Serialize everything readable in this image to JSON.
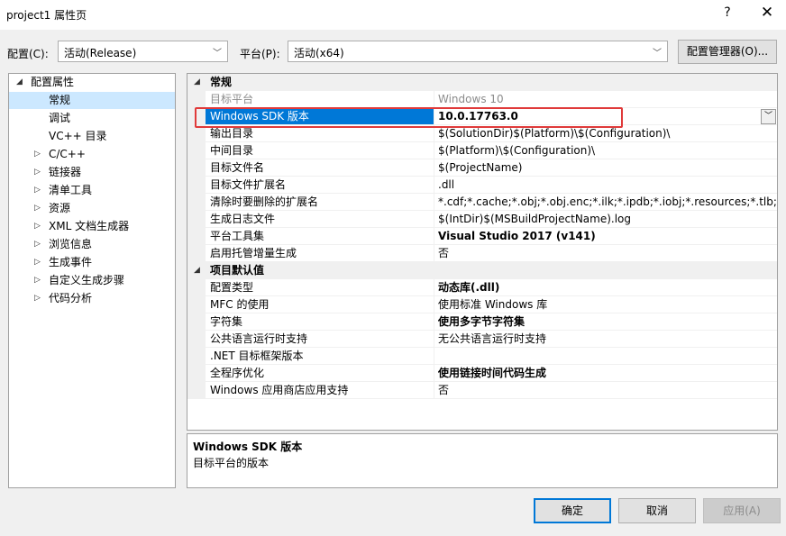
{
  "window": {
    "title": "project1 属性页",
    "help": "?",
    "close": "✕"
  },
  "config_bar": {
    "config_label": "配置(C):",
    "config_value": "活动(Release)",
    "platform_label": "平台(P):",
    "platform_value": "活动(x64)",
    "manager_button": "配置管理器(O)..."
  },
  "tree": {
    "items": [
      {
        "label": "配置属性",
        "expander": "◢"
      },
      {
        "label": "常规",
        "expander": ""
      },
      {
        "label": "调试",
        "expander": ""
      },
      {
        "label": "VC++ 目录",
        "expander": ""
      },
      {
        "label": "C/C++",
        "expander": "▷"
      },
      {
        "label": "链接器",
        "expander": "▷"
      },
      {
        "label": "清单工具",
        "expander": "▷"
      },
      {
        "label": "资源",
        "expander": "▷"
      },
      {
        "label": "XML 文档生成器",
        "expander": "▷"
      },
      {
        "label": "浏览信息",
        "expander": "▷"
      },
      {
        "label": "生成事件",
        "expander": "▷"
      },
      {
        "label": "自定义生成步骤",
        "expander": "▷"
      },
      {
        "label": "代码分析",
        "expander": "▷"
      }
    ],
    "selected": "常规"
  },
  "grid": {
    "sections": [
      {
        "title": "常规",
        "expander": "◢",
        "rows": [
          {
            "name": "目标平台",
            "value": "Windows 10"
          },
          {
            "name": "Windows SDK 版本",
            "value": "10.0.17763.0"
          },
          {
            "name": "输出目录",
            "value": "$(SolutionDir)$(Platform)\\$(Configuration)\\"
          },
          {
            "name": "中间目录",
            "value": "$(Platform)\\$(Configuration)\\"
          },
          {
            "name": "目标文件名",
            "value": "$(ProjectName)"
          },
          {
            "name": "目标文件扩展名",
            "value": ".dll"
          },
          {
            "name": "清除时要删除的扩展名",
            "value": "*.cdf;*.cache;*.obj;*.obj.enc;*.ilk;*.ipdb;*.iobj;*.resources;*.tlb;*.tli;*.t"
          },
          {
            "name": "生成日志文件",
            "value": "$(IntDir)$(MSBuildProjectName).log"
          },
          {
            "name": "平台工具集",
            "value": "Visual Studio 2017 (v141)"
          },
          {
            "name": "启用托管增量生成",
            "value": "否"
          }
        ]
      },
      {
        "title": "项目默认值",
        "expander": "◢",
        "rows": [
          {
            "name": "配置类型",
            "value": "动态库(.dll)"
          },
          {
            "name": "MFC 的使用",
            "value": "使用标准 Windows 库"
          },
          {
            "name": "字符集",
            "value": "使用多字节字符集"
          },
          {
            "name": "公共语言运行时支持",
            "value": "无公共语言运行时支持"
          },
          {
            "name": ".NET 目标框架版本",
            "value": ""
          },
          {
            "name": "全程序优化",
            "value": "使用链接时间代码生成"
          },
          {
            "name": "Windows 应用商店应用支持",
            "value": "否"
          }
        ]
      }
    ],
    "dropdown_arrow": "﹀"
  },
  "description": {
    "title": "Windows SDK 版本",
    "text": "目标平台的版本"
  },
  "footer": {
    "ok": "确定",
    "cancel": "取消",
    "apply": "应用(A)"
  },
  "colors": {
    "selection": "#0078d7",
    "tree_selection": "#cce8ff",
    "highlight_box": "#e03a3a"
  }
}
